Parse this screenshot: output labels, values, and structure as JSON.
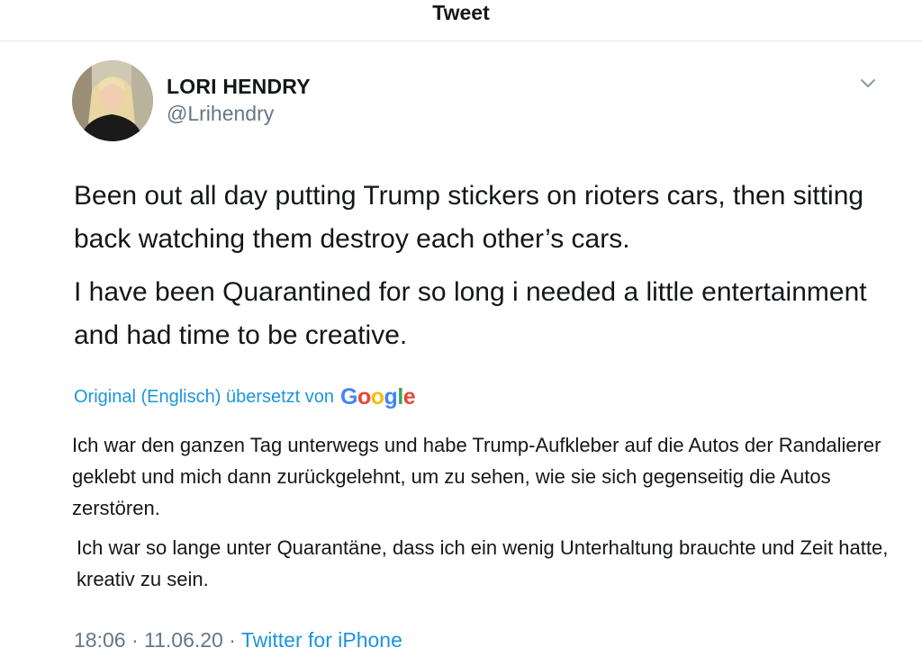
{
  "header": {
    "title": "Tweet"
  },
  "author": {
    "name": "LORI HENDRY",
    "handle": "@Lrihendry"
  },
  "tweet": {
    "paragraphs": [
      "Been out all day putting Trump stickers on rioters cars, then sitting back watching them destroy each other’s cars.",
      "I have been Quarantined for so long i needed a little entertainment and had time to be creative."
    ]
  },
  "translation": {
    "label": "Original (Englisch) übersetzt von",
    "provider_letters": [
      "G",
      "o",
      "o",
      "g",
      "l",
      "e"
    ],
    "provider_colors": [
      "#4285F4",
      "#EA4335",
      "#FBBC05",
      "#4285F4",
      "#34A853",
      "#EA4335"
    ],
    "paragraphs": [
      "Ich war den ganzen Tag unterwegs und habe Trump-Aufkleber auf die Autos der Randalierer geklebt und mich dann zurückgelehnt, um zu sehen, wie sie sich gegenseitig die Autos zerstören.",
      "Ich war so lange unter Quarantäne, dass ich ein wenig Unterhaltung brauchte und Zeit hatte, kreativ zu sein."
    ]
  },
  "meta": {
    "time": "18:06",
    "separator": "·",
    "date": "11.06.20",
    "source": "Twitter for iPhone"
  },
  "colors": {
    "link": "#1b95e0",
    "secondary_text": "#657786",
    "primary_text": "#14171a",
    "divider": "#e6ecf0"
  },
  "icons": {
    "menu": "chevron-down-icon",
    "avatar": "profile-photo"
  }
}
